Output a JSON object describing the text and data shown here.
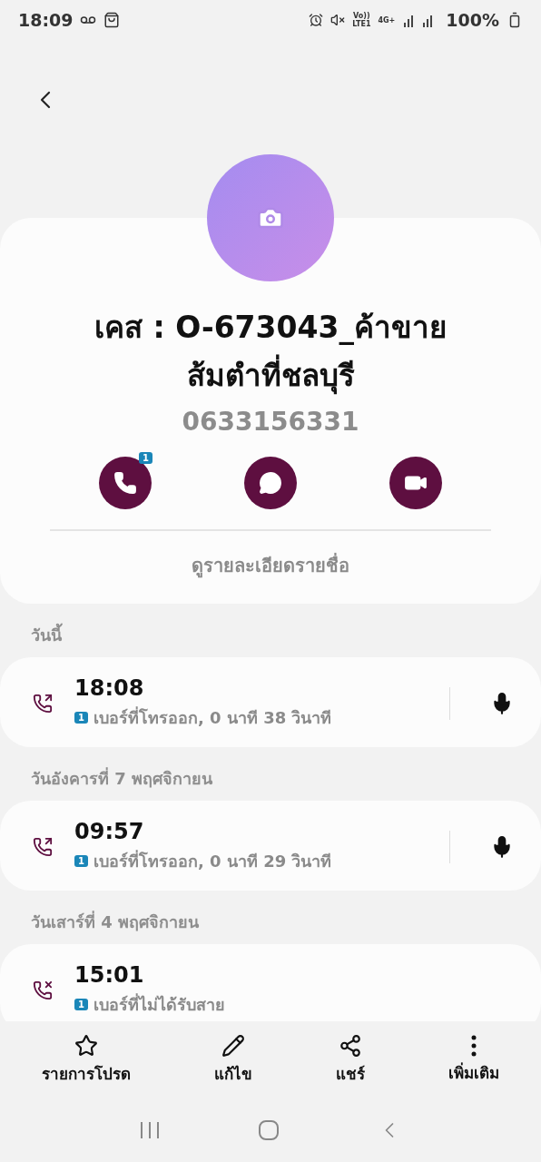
{
  "status_bar": {
    "time": "18:09",
    "network_top": "Vo))",
    "network_bottom": "LTE1",
    "data_type": "4G+",
    "battery": "100%"
  },
  "contact": {
    "name": "เคส : O-673043_ค้าขาย ส้มตำที่ชลบุรี",
    "phone": "0633156331"
  },
  "actions": [
    {
      "kind": "call",
      "badge": "1"
    },
    {
      "kind": "message"
    },
    {
      "kind": "video"
    }
  ],
  "details_link": "ดูรายละเอียดรายชื่อ",
  "call_log": [
    {
      "heading": "วันนี้",
      "entries": [
        {
          "time": "18:08",
          "kind": "outgoing",
          "sim": "1",
          "description": "เบอร์ที่โทรออก, 0 นาที 38 วินาที",
          "recording": true
        }
      ]
    },
    {
      "heading": "วันอังคารที่ 7 พฤศจิกายน",
      "entries": [
        {
          "time": "09:57",
          "kind": "outgoing",
          "sim": "1",
          "description": "เบอร์ที่โทรออก, 0 นาที 29 วินาที",
          "recording": true
        }
      ]
    },
    {
      "heading": "วันเสาร์ที่ 4 พฤศจิกายน",
      "entries": [
        {
          "time": "15:01",
          "kind": "missed",
          "sim": "1",
          "description": "เบอร์ที่ไม่ได้รับสาย",
          "recording": false
        }
      ]
    }
  ],
  "bottom_actions": [
    {
      "kind": "favorite",
      "label": "รายการโปรด"
    },
    {
      "kind": "edit",
      "label": "แก้ไข"
    },
    {
      "kind": "share",
      "label": "แชร์"
    },
    {
      "kind": "more",
      "label": "เพิ่มเติม"
    }
  ]
}
